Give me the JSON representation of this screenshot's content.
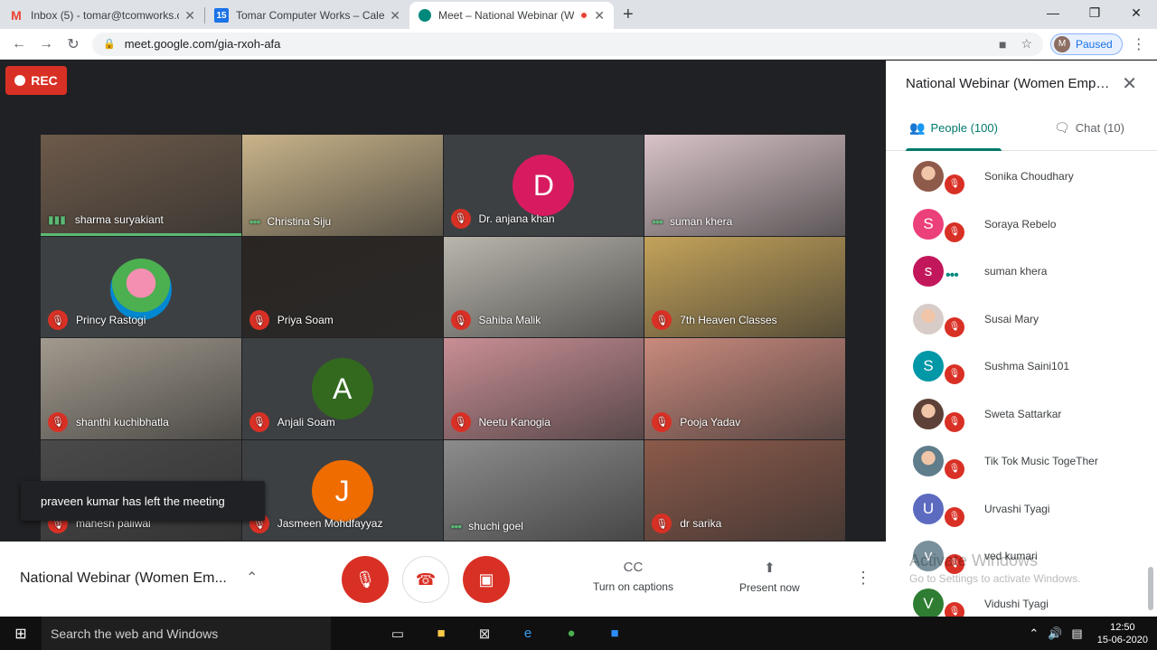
{
  "browser": {
    "tabs": [
      {
        "title": "Inbox (5) - tomar@tcomworks.co",
        "icon": "gmail-icon",
        "active": false
      },
      {
        "title": "Tomar Computer Works – Calend",
        "icon": "calendar-icon",
        "active": false
      },
      {
        "title": "Meet – National Webinar (W",
        "icon": "meet-icon",
        "active": true
      }
    ],
    "url": "meet.google.com/gia-rxoh-afa",
    "profile_initial": "M",
    "profile_status": "Paused"
  },
  "meet": {
    "rec_label": "REC",
    "toast": "praveen kumar has left the meeting",
    "meeting_name": "National Webinar (Women Em...",
    "captions_label": "Turn on captions",
    "present_label": "Present now",
    "tiles": [
      {
        "name": "sharma suryakiant",
        "state": "speaking",
        "bg": "#6d5a4a"
      },
      {
        "name": "Christina Siju",
        "state": "dots",
        "bg": "#c9b48a"
      },
      {
        "name": "Dr. anjana khan",
        "state": "muted",
        "initial": "D",
        "initial_color": "#d81b60"
      },
      {
        "name": "suman khera",
        "state": "dots",
        "bg": "#d8c3c8"
      },
      {
        "name": "Princy Rastogi",
        "state": "muted",
        "photo": true
      },
      {
        "name": "Priya Soam",
        "state": "muted",
        "bg": "#2a2522"
      },
      {
        "name": "Sahiba Malik",
        "state": "muted",
        "bg": "#b9b6ad"
      },
      {
        "name": "7th Heaven Classes",
        "state": "muted",
        "bg": "#c4a35a"
      },
      {
        "name": "shanthi kuchibhatla",
        "state": "muted",
        "bg": "#a29a8e"
      },
      {
        "name": "Anjali Soam",
        "state": "muted",
        "initial": "A",
        "initial_color": "#33691e"
      },
      {
        "name": "Neetu Kanogia",
        "state": "muted",
        "bg": "#c98f95"
      },
      {
        "name": "Pooja Yadav",
        "state": "muted",
        "bg": "#c98a7d"
      },
      {
        "name": "mahesh paliwal",
        "state": "muted",
        "bg": "#4a4a4a"
      },
      {
        "name": "Jasmeen Mohdfayyaz",
        "state": "muted",
        "initial": "J",
        "initial_color": "#ef6c00"
      },
      {
        "name": "shuchi goel",
        "state": "dots",
        "bg": "#8c8c8c"
      },
      {
        "name": "dr sarika",
        "state": "muted",
        "bg": "#8b5a4a"
      }
    ]
  },
  "panel": {
    "title": "National Webinar (Women Empo...",
    "people_tab": "People (100)",
    "chat_tab": "Chat (10)",
    "people": [
      {
        "name": "Sonika Choudhary",
        "avatar": "photo",
        "color": "#8e5a4a",
        "status": "muted"
      },
      {
        "name": "Soraya Rebelo",
        "initial": "S",
        "color": "#ec407a",
        "status": "muted"
      },
      {
        "name": "suman khera",
        "initial": "s",
        "color": "#c2185b",
        "status": "speaking"
      },
      {
        "name": "Susai Mary",
        "avatar": "photo",
        "color": "#d7ccc8",
        "status": "muted"
      },
      {
        "name": "Sushma Saini101",
        "initial": "S",
        "color": "#0097a7",
        "status": "muted"
      },
      {
        "name": "Sweta Sattarkar",
        "avatar": "photo",
        "color": "#5d4037",
        "status": "muted"
      },
      {
        "name": "Tik Tok Music TogeTher",
        "avatar": "photo",
        "color": "#607d8b",
        "status": "muted"
      },
      {
        "name": "Urvashi Tyagi",
        "initial": "U",
        "color": "#5c6bc0",
        "status": "muted"
      },
      {
        "name": "ved kumari",
        "initial": "v",
        "color": "#78909c",
        "status": "muted"
      },
      {
        "name": "Vidushi Tyagi",
        "initial": "V",
        "color": "#2e7d32",
        "status": "muted"
      }
    ],
    "watermark_line1": "Activate Windows",
    "watermark_line2": "Go to Settings to activate Windows."
  },
  "taskbar": {
    "search_placeholder": "Search the web and Windows",
    "time": "12:50",
    "date": "15-06-2020"
  }
}
